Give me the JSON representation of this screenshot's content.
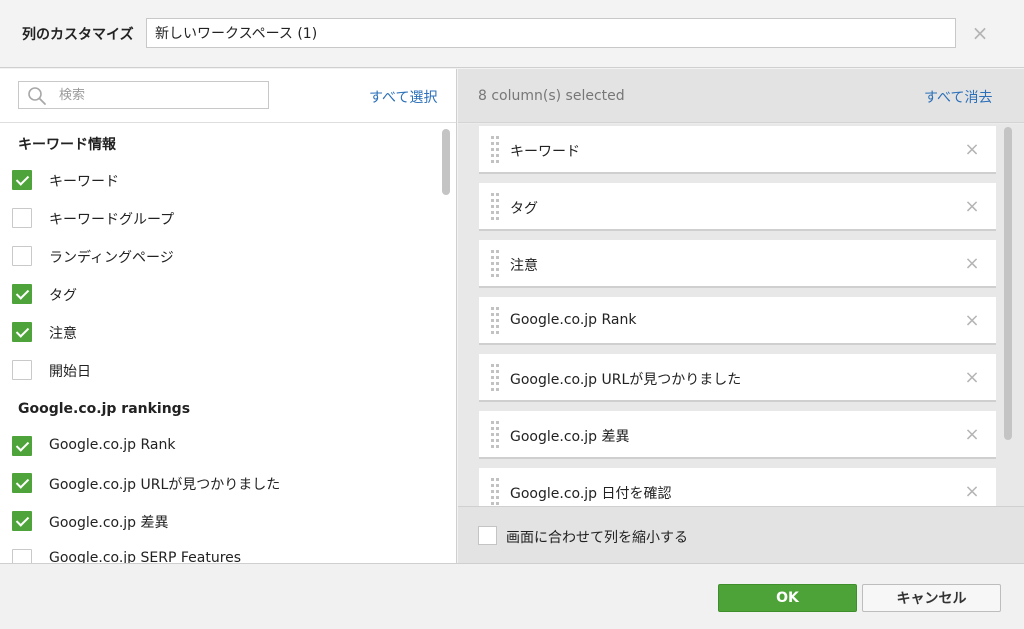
{
  "header": {
    "label": "列のカスタマイズ",
    "title_value": "新しいワークスペース (1)",
    "close_icon": "×"
  },
  "left": {
    "search_placeholder": "検索",
    "select_all": "すべて選択",
    "groups": [
      {
        "title": "キーワード情報",
        "items": [
          {
            "label": "キーワード",
            "checked": true
          },
          {
            "label": "キーワードグループ",
            "checked": false
          },
          {
            "label": "ランディングページ",
            "checked": false
          },
          {
            "label": "タグ",
            "checked": true
          },
          {
            "label": "注意",
            "checked": true
          },
          {
            "label": "開始日",
            "checked": false
          }
        ]
      },
      {
        "title": "Google.co.jp rankings",
        "items": [
          {
            "label": "Google.co.jp Rank",
            "checked": true
          },
          {
            "label": "Google.co.jp URLが見つかりました",
            "checked": true
          },
          {
            "label": "Google.co.jp 差異",
            "checked": true
          },
          {
            "label": "Google.co.jp SERP Features",
            "checked": false
          }
        ]
      }
    ]
  },
  "right": {
    "selected_count": "8 column(s) selected",
    "clear_all": "すべて消去",
    "selected": [
      "キーワード",
      "タグ",
      "注意",
      "Google.co.jp Rank",
      "Google.co.jp URLが見つかりました",
      "Google.co.jp 差異",
      "Google.co.jp 日付を確認"
    ],
    "remove_icon": "×",
    "shrink_label": "画面に合わせて列を縮小する",
    "shrink_checked": false
  },
  "footer": {
    "ok": "OK",
    "cancel": "キャンセル"
  },
  "colors": {
    "accent_green": "#4ea338",
    "link_blue": "#2a6fb8"
  }
}
